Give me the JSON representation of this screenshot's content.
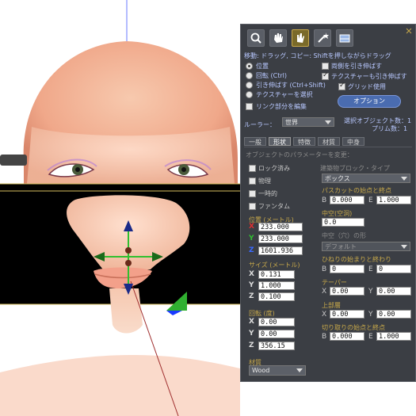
{
  "toolbar": {
    "tools": [
      {
        "icon": "zoom-icon"
      },
      {
        "icon": "grab-icon"
      },
      {
        "icon": "edit-icon"
      },
      {
        "icon": "create-wand-icon"
      },
      {
        "icon": "land-icon"
      }
    ]
  },
  "edit_modes": {
    "header": "移動: ドラッグ, コピー: Shiftを押しながらドラッグ",
    "position": "位置",
    "rotate": "回転 (Ctrl)",
    "stretch": "引き伸ばす (Ctrl+Shift)",
    "select_texture": "テクスチャーを選択",
    "edit_linked": "リンク部分を編集",
    "stretch_both_sides": "両側を引き伸ばす",
    "stretch_textures": "テクスチャーも引き伸ばす",
    "use_grid": "グリッド使用",
    "options_button": "オプション"
  },
  "ruler": {
    "label": "ルーラー：",
    "value": "世界"
  },
  "counts": {
    "objects_label": "選択オブジェクト数：",
    "objects_value": "1",
    "prims_label": "プリム数：",
    "prims_value": "1"
  },
  "tabs": [
    "一般",
    "形状",
    "特徴",
    "材質",
    "中身"
  ],
  "object_params": {
    "heading": "オブジェクトのパラメーターを変更：",
    "locked": "ロック済み",
    "physical": "物理",
    "temporary": "一時的",
    "phantom": "ファンタム",
    "building_block_label": "建築物ブロック・タイプ",
    "building_block_value": "ボックス"
  },
  "position": {
    "label": "位置 (メートル)",
    "x": "233.000",
    "y": "233.000",
    "z": "1601.936"
  },
  "size": {
    "label": "サイズ (メートル)",
    "x": "0.131",
    "y": "1.000",
    "z": "0.100"
  },
  "rotation": {
    "label": "回転 (度)",
    "x": "0.00",
    "y": "0.00",
    "z": "356.15"
  },
  "material": {
    "label": "材質",
    "value": "Wood"
  },
  "path_cut": {
    "label": "パスカットの始点と終点",
    "b_label": "B",
    "b": "0.000",
    "e_label": "E",
    "e": "1.000"
  },
  "hollow": {
    "label": "中空(空洞)",
    "value": "0.0"
  },
  "hollow_shape": {
    "label": "中空（穴）の形",
    "value": "デフォルト"
  },
  "twist": {
    "label": "ひねりの始まりと終わり",
    "b_label": "B",
    "b": "0",
    "e_label": "E",
    "e": "0"
  },
  "taper": {
    "label": "テーパー",
    "x_label": "X",
    "x": "0.00",
    "y_label": "Y",
    "y": "0.00"
  },
  "top_shear": {
    "label": "上部層",
    "x_label": "X",
    "x": "0.00",
    "y_label": "Y",
    "y": "0.00"
  },
  "slice": {
    "label": "切り取りの始点と終点",
    "b_label": "B",
    "b": "0.000",
    "e_label": "E",
    "e": "1.000"
  },
  "axis": {
    "x": "X",
    "y": "Y",
    "z": "Z"
  },
  "colors": {
    "panel_bg": "#3b3e44",
    "label_gold": "#c8a94a",
    "x_axis": "#e03030",
    "y_axis": "#30c030",
    "z_axis": "#3a6aff"
  }
}
